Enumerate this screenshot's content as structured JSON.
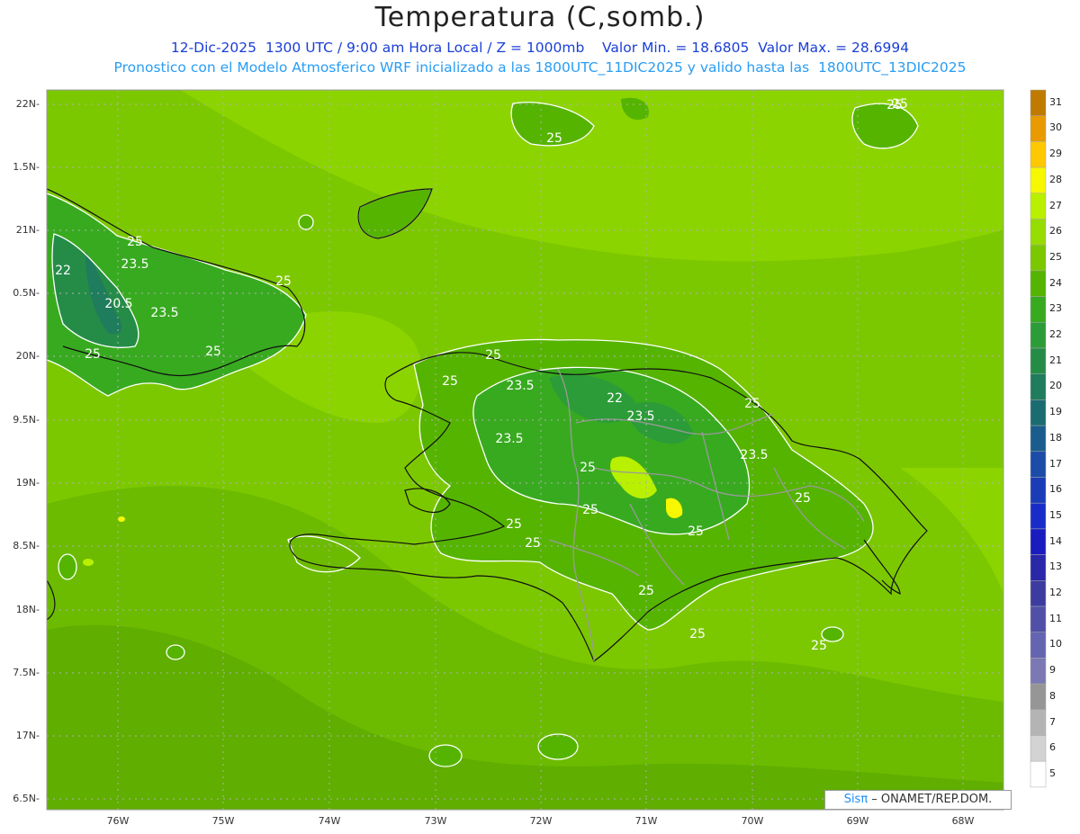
{
  "title": "Temperatura (C,somb.)",
  "subtitle1": "12-Dic-2025  1300 UTC / 9:00 am Hora Local / Z = 1000mb    Valor Min. = 18.6805  Valor Max. = 28.6994",
  "subtitle2": "Pronostico con el Modelo Atmosferico WRF inicializado a las 1800UTC_11DIC2025 y valido hasta las  1800UTC_13DIC2025",
  "credit": {
    "brand": "Sisπ",
    "org": " – ONAMET/REP.DOM."
  },
  "lat_labels": [
    "22N",
    "1.5N",
    "21N",
    "0.5N",
    "20N",
    "9.5N",
    "19N",
    "8.5N",
    "18N",
    "7.5N",
    "17N",
    "6.5N"
  ],
  "lon_labels": [
    "76W",
    "75W",
    "74W",
    "73W",
    "72W",
    "71W",
    "70W",
    "69W",
    "68W"
  ],
  "colorbar": {
    "labels": [
      "31",
      "30",
      "29",
      "28",
      "27",
      "26",
      "25",
      "24",
      "23",
      "22",
      "21",
      "20",
      "19",
      "18",
      "17",
      "16",
      "15",
      "14",
      "13",
      "12",
      "11",
      "10",
      "9",
      "8",
      "7",
      "6",
      "5"
    ],
    "colors": [
      "#c07a00",
      "#e89a00",
      "#ffc800",
      "#f7f700",
      "#b8f000",
      "#96dc00",
      "#7cc800",
      "#55b400",
      "#38aa20",
      "#2c9c38",
      "#258c48",
      "#1f7c5c",
      "#1a6c70",
      "#1a5c8c",
      "#1a4ca8",
      "#1a3cb8",
      "#1a2cc8",
      "#1a1cc0",
      "#2828a8",
      "#3c3ca0",
      "#5050a8",
      "#6464b0",
      "#7c78b4",
      "#969696",
      "#b4b4b4",
      "#d2d2d2",
      "#ffffff"
    ]
  },
  "contour_labels": [
    {
      "text": "25"
    },
    {
      "text": "25"
    },
    {
      "text": "23.5"
    },
    {
      "text": "22"
    },
    {
      "text": "20.5"
    },
    {
      "text": "23.5"
    },
    {
      "text": "25"
    },
    {
      "text": "25"
    },
    {
      "text": "25"
    },
    {
      "text": "25"
    },
    {
      "text": "25"
    },
    {
      "text": "23.5"
    },
    {
      "text": "22"
    },
    {
      "text": "23.5"
    },
    {
      "text": "23.5"
    },
    {
      "text": "23.5"
    },
    {
      "text": "25"
    },
    {
      "text": "25"
    },
    {
      "text": "25"
    },
    {
      "text": "25"
    },
    {
      "text": "25"
    },
    {
      "text": "25"
    },
    {
      "text": "25"
    },
    {
      "text": "25"
    },
    {
      "text": "25"
    },
    {
      "text": "25"
    },
    {
      "text": "25"
    },
    {
      "text": "25"
    }
  ],
  "colors": {
    "background_field": "#8cd400",
    "land_cool": "#2fa52a",
    "coast": "#111111",
    "borders": "#9a9a9a",
    "contour": "#ffffff"
  }
}
